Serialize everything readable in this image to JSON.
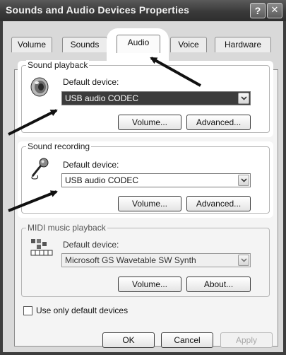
{
  "window": {
    "title": "Sounds and Audio Devices Properties",
    "help_glyph": "?",
    "close_glyph": "✕"
  },
  "tabs": [
    {
      "label": "Volume",
      "active": false
    },
    {
      "label": "Sounds",
      "active": false
    },
    {
      "label": "Audio",
      "active": true
    },
    {
      "label": "Voice",
      "active": false
    },
    {
      "label": "Hardware",
      "active": false
    }
  ],
  "playback": {
    "group_title": "Sound playback",
    "default_device_label": "Default device:",
    "device_value": "USB audio CODEC",
    "volume_button": "Volume...",
    "advanced_button": "Advanced..."
  },
  "recording": {
    "group_title": "Sound recording",
    "default_device_label": "Default device:",
    "device_value": "USB audio CODEC",
    "volume_button": "Volume...",
    "advanced_button": "Advanced..."
  },
  "midi": {
    "group_title": "MIDI music playback",
    "default_device_label": "Default device:",
    "device_value": "Microsoft GS Wavetable SW Synth",
    "volume_button": "Volume...",
    "about_button": "About..."
  },
  "options": {
    "use_only_default_label": "Use only default devices",
    "use_only_default_checked": false
  },
  "footer": {
    "ok_label": "OK",
    "cancel_label": "Cancel",
    "apply_label": "Apply"
  }
}
